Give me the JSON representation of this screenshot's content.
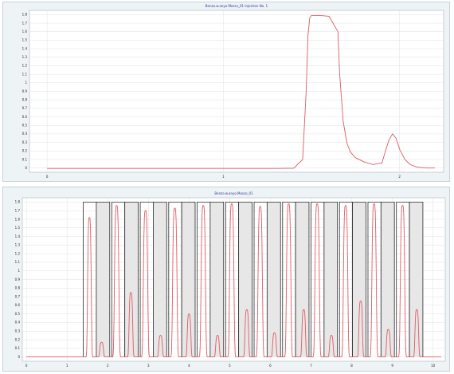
{
  "chart_data": [
    {
      "type": "line",
      "title": "Benzo.w.anyo.Mosso_01 Injection No. 1",
      "line_color": "#e05b63",
      "plot_bg": "#ffffff",
      "panel_bg": "#eef3f6",
      "grid": true,
      "xlim": [
        -0.1,
        2.25
      ],
      "ylim": [
        -0.05,
        1.85
      ],
      "x_ticks": [
        0,
        1,
        2
      ],
      "x_tick_labels": [
        "0",
        "1",
        "2"
      ],
      "y_ticks": [
        -0.1,
        0,
        0.1,
        0.2,
        0.3,
        0.4,
        0.5,
        0.6,
        0.7,
        0.8,
        0.9,
        1,
        1.1,
        1.2,
        1.3,
        1.4,
        1.5,
        1.6,
        1.7,
        1.8
      ],
      "y_tick_labels": [
        "-0.1",
        "0",
        "0.1",
        "0.2",
        "0.3",
        "0.4",
        "0.5",
        "0.6",
        "0.7",
        "0.8",
        "0.9",
        "1",
        "1.1",
        "1.2",
        "1.3",
        "1.4",
        "1.5",
        "1.6",
        "1.7",
        "1.8"
      ],
      "series": [
        {
          "x": [
            0,
            0.2,
            0.4,
            0.6,
            0.8,
            1.0,
            1.2,
            1.3,
            1.4,
            1.45,
            1.47,
            1.48,
            1.49,
            1.5,
            1.55,
            1.6,
            1.65,
            1.66,
            1.68,
            1.7,
            1.72,
            1.75,
            1.8,
            1.85,
            1.9,
            1.92,
            1.94,
            1.96,
            1.98,
            2.0,
            2.03,
            2.06,
            2.1,
            2.15,
            2.2
          ],
          "y": [
            -0.005,
            -0.005,
            -0.005,
            -0.005,
            -0.005,
            -0.005,
            -0.005,
            -0.005,
            -0.002,
            0.1,
            0.9,
            1.55,
            1.76,
            1.79,
            1.79,
            1.78,
            1.6,
            1.1,
            0.55,
            0.3,
            0.19,
            0.12,
            0.07,
            0.04,
            0.06,
            0.2,
            0.33,
            0.4,
            0.35,
            0.22,
            0.1,
            0.04,
            0.01,
            0.0,
            0.0
          ]
        }
      ]
    },
    {
      "type": "line",
      "title": "Benzo.w.anyo.Mosso_01",
      "line_color": "#e05b63",
      "box_color": "#2b2b2b",
      "shade_color": "#e7e7e7",
      "plot_bg": "#ffffff",
      "panel_bg": "#eef3f6",
      "grid": true,
      "xlim": [
        -0.1,
        10.3
      ],
      "ylim": [
        -0.05,
        1.85
      ],
      "x_ticks": [
        0,
        1,
        2,
        3,
        4,
        5,
        6,
        7,
        8,
        9,
        10
      ],
      "x_tick_labels": [
        "0",
        "1",
        "2",
        "3",
        "4",
        "5",
        "6",
        "7",
        "8",
        "9",
        "10"
      ],
      "y_ticks": [
        -0.1,
        0,
        0.1,
        0.2,
        0.3,
        0.4,
        0.5,
        0.6,
        0.7,
        0.8,
        0.9,
        1,
        1.1,
        1.2,
        1.3,
        1.4,
        1.5,
        1.6,
        1.7,
        1.8
      ],
      "y_tick_labels": [
        "-0.1",
        "0",
        "0.1",
        "0.2",
        "0.3",
        "0.4",
        "0.5",
        "0.6",
        "0.7",
        "0.8",
        "0.9",
        "1",
        "1.1",
        "1.2",
        "1.3",
        "1.4",
        "1.5",
        "1.6",
        "1.7",
        "1.8"
      ],
      "baseline": 0,
      "box_top": 1.8,
      "boxes": [
        [
          1.4,
          1.72
        ],
        [
          1.72,
          2.05
        ],
        [
          2.1,
          2.42
        ],
        [
          2.42,
          2.75
        ],
        [
          2.8,
          3.12
        ],
        [
          3.12,
          3.45
        ],
        [
          3.5,
          3.82
        ],
        [
          3.82,
          4.15
        ],
        [
          4.2,
          4.52
        ],
        [
          4.52,
          4.85
        ],
        [
          4.9,
          5.22
        ],
        [
          5.22,
          5.55
        ],
        [
          5.6,
          5.92
        ],
        [
          5.92,
          6.25
        ],
        [
          6.3,
          6.62
        ],
        [
          6.62,
          6.95
        ],
        [
          7.0,
          7.32
        ],
        [
          7.32,
          7.65
        ],
        [
          7.7,
          8.02
        ],
        [
          8.02,
          8.35
        ],
        [
          8.4,
          8.72
        ],
        [
          8.72,
          9.05
        ],
        [
          9.1,
          9.42
        ],
        [
          9.42,
          9.75
        ]
      ],
      "peaks": [
        {
          "x": 1.55,
          "y": 1.62,
          "w": 0.05
        },
        {
          "x": 1.85,
          "y": 0.17,
          "w": 0.05
        },
        {
          "x": 2.22,
          "y": 1.76,
          "w": 0.06
        },
        {
          "x": 2.57,
          "y": 0.75,
          "w": 0.05
        },
        {
          "x": 2.93,
          "y": 1.7,
          "w": 0.06
        },
        {
          "x": 3.3,
          "y": 0.25,
          "w": 0.05
        },
        {
          "x": 3.65,
          "y": 1.73,
          "w": 0.06
        },
        {
          "x": 4.0,
          "y": 0.5,
          "w": 0.05
        },
        {
          "x": 4.35,
          "y": 1.76,
          "w": 0.06
        },
        {
          "x": 4.7,
          "y": 0.25,
          "w": 0.05
        },
        {
          "x": 5.05,
          "y": 1.78,
          "w": 0.06
        },
        {
          "x": 5.42,
          "y": 0.55,
          "w": 0.05
        },
        {
          "x": 5.75,
          "y": 1.75,
          "w": 0.06
        },
        {
          "x": 6.1,
          "y": 0.28,
          "w": 0.05
        },
        {
          "x": 6.45,
          "y": 1.78,
          "w": 0.06
        },
        {
          "x": 6.82,
          "y": 0.55,
          "w": 0.05
        },
        {
          "x": 7.15,
          "y": 1.78,
          "w": 0.06
        },
        {
          "x": 7.5,
          "y": 0.25,
          "w": 0.05
        },
        {
          "x": 7.85,
          "y": 1.76,
          "w": 0.06
        },
        {
          "x": 8.22,
          "y": 0.65,
          "w": 0.05
        },
        {
          "x": 8.55,
          "y": 1.78,
          "w": 0.06
        },
        {
          "x": 8.9,
          "y": 0.32,
          "w": 0.05
        },
        {
          "x": 9.25,
          "y": 1.76,
          "w": 0.06
        },
        {
          "x": 9.6,
          "y": 0.55,
          "w": 0.05
        }
      ]
    }
  ]
}
